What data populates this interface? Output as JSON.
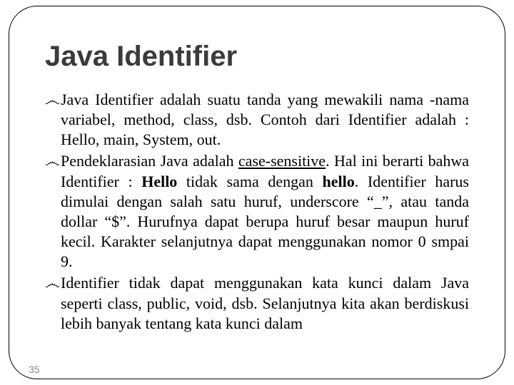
{
  "title": "Java Identifier",
  "bullet_glyph": "෴",
  "items": [
    {
      "prefix": "Java Identifier adalah suatu tanda yang mewakili nama -nama variabel, method, class, dsb. Contoh dari Identifier adalah : Hello, main, System, out."
    },
    {
      "prefix": "Pendeklarasian Java adalah ",
      "case_sensitive": "case-sensitive",
      "mid1": ". Hal ini berarti bahwa Identifier : ",
      "hello_upper": "Hello",
      "mid2": " tidak sama dengan ",
      "hello_lower": "hello",
      "suffix": ". Identifier harus dimulai dengan salah satu huruf, underscore “_”, atau tanda  dollar “$”.  Hurufnya dapat berupa huruf besar maupun huruf kecil. Karakter selanjutnya dapat menggunakan nomor 0 smpai 9."
    },
    {
      "prefix": " Identifier tidak dapat menggunakan kata kunci dalam Java seperti class, public, void, dsb. Selanjutnya kita akan berdiskusi lebih banyak tentang kata kunci dalam"
    }
  ],
  "slide_number": "35"
}
